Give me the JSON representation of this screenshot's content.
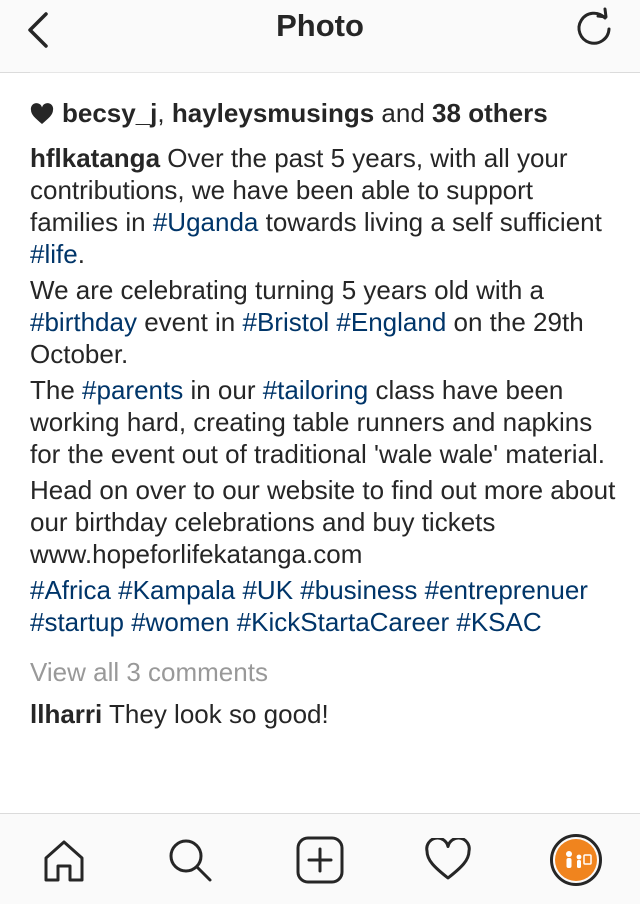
{
  "header": {
    "title": "Photo"
  },
  "likes": {
    "user1": "becsy_j",
    "separator": ",",
    "user2": "hayleysmusings",
    "and_text": "and",
    "others": "38 others"
  },
  "caption": {
    "username": "hflkatanga",
    "paragraphs": [
      [
        {
          "t": "Over the past 5 years, with all your contributions, we have been able to support families in "
        },
        {
          "t": "#Uganda",
          "tag": true
        },
        {
          "t": " towards living a self sufficient "
        },
        {
          "t": "#life",
          "tag": true
        },
        {
          "t": "."
        }
      ],
      [
        {
          "t": "We are celebrating turning 5 years old with a "
        },
        {
          "t": "#birthday",
          "tag": true
        },
        {
          "t": " event in "
        },
        {
          "t": "#Bristol",
          "tag": true
        },
        {
          "t": " "
        },
        {
          "t": "#England",
          "tag": true
        },
        {
          "t": " on the 29th October."
        }
      ],
      [
        {
          "t": "The "
        },
        {
          "t": "#parents",
          "tag": true
        },
        {
          "t": " in our "
        },
        {
          "t": "#tailoring",
          "tag": true
        },
        {
          "t": " class have been working hard, creating table runners and napkins for the event out of traditional 'wale wale' material."
        }
      ],
      [
        {
          "t": "Head on over to our website to find out more about our birthday celebrations and buy tickets www.hopeforlifekatanga.com"
        }
      ],
      [
        {
          "t": "#Africa",
          "tag": true
        },
        {
          "t": " "
        },
        {
          "t": "#Kampala",
          "tag": true
        },
        {
          "t": " "
        },
        {
          "t": "#UK",
          "tag": true
        },
        {
          "t": " "
        },
        {
          "t": "#business",
          "tag": true
        },
        {
          "t": " "
        },
        {
          "t": "#entreprenuer",
          "tag": true
        },
        {
          "t": " "
        },
        {
          "t": "#startup",
          "tag": true
        },
        {
          "t": " "
        },
        {
          "t": "#women",
          "tag": true
        },
        {
          "t": " "
        },
        {
          "t": "#KickStartaCareer",
          "tag": true
        },
        {
          "t": " "
        },
        {
          "t": "#KSAC",
          "tag": true
        }
      ]
    ]
  },
  "comments": {
    "view_all": "View all 3 comments",
    "items": [
      {
        "user": "llharri",
        "text": "They look so good!"
      }
    ]
  },
  "tabbar": {
    "tabs": [
      "home-icon",
      "search-icon",
      "new-post-icon",
      "activity-heart-icon",
      "profile-avatar"
    ]
  },
  "colors": {
    "hashtag": "#003569",
    "muted": "#999999",
    "text": "#262626",
    "avatar": "#f0841e"
  }
}
